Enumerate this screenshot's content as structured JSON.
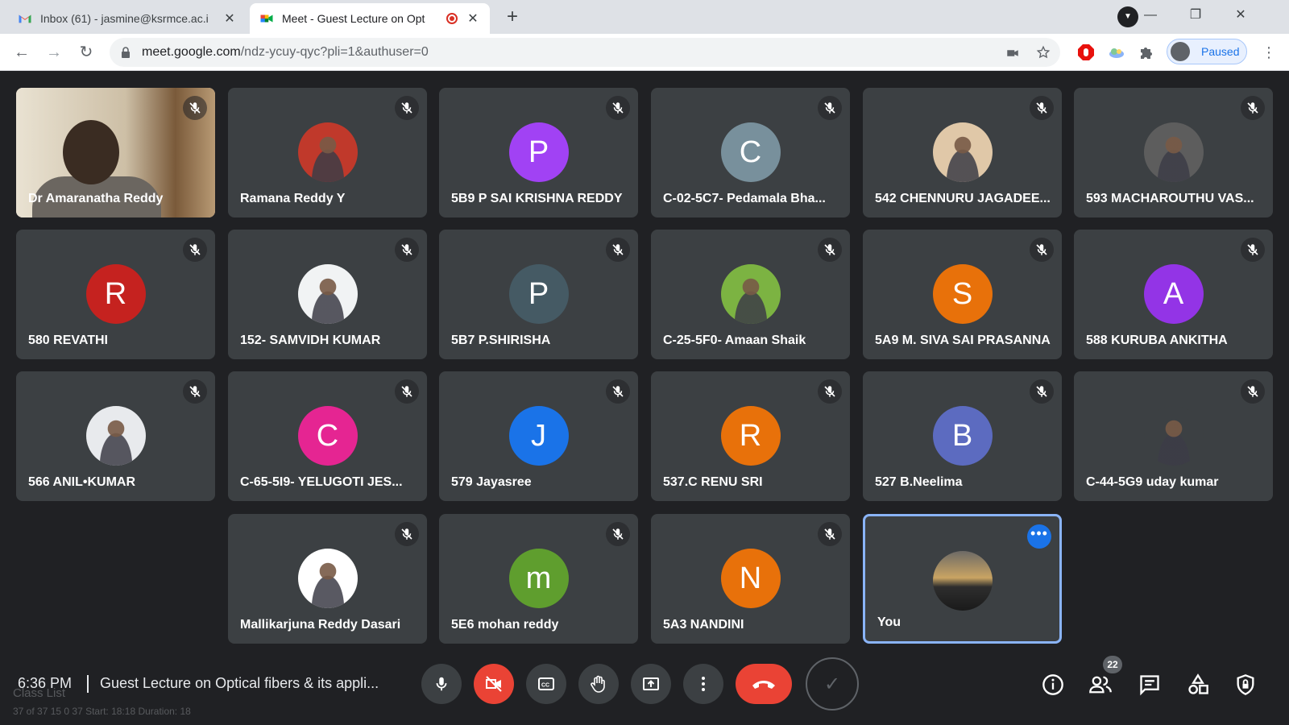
{
  "browser": {
    "tabs": [
      {
        "title": "Inbox (61) - jasmine@ksrmce.ac.i",
        "icon": "gmail-icon"
      },
      {
        "title": "Meet - Guest Lecture on Opt",
        "icon": "meet-icon",
        "recording": true
      }
    ],
    "url_host": "meet.google.com",
    "url_path": "/ndz-ycuy-qyc?pli=1&authuser=0",
    "profile_label": "Paused"
  },
  "participants": [
    {
      "name": "Dr Amaranatha Reddy",
      "type": "video"
    },
    {
      "name": "Ramana Reddy Y",
      "type": "photo",
      "color": "#c0392b"
    },
    {
      "name": "5B9 P SAI KRISHNA REDDY",
      "type": "initial",
      "initial": "P",
      "color": "#a142f4"
    },
    {
      "name": "C-02-5C7- Pedamala Bha...",
      "type": "initial",
      "initial": "C",
      "color": "#78909c"
    },
    {
      "name": "542 CHENNURU JAGADEE...",
      "type": "photo",
      "color": "#e0c8a8"
    },
    {
      "name": "593 MACHAROUTHU VAS...",
      "type": "photo",
      "color": "#5d5d5d"
    },
    {
      "name": "580 REVATHI",
      "type": "initial",
      "initial": "R",
      "color": "#c5221f"
    },
    {
      "name": "152- SAMVIDH KUMAR",
      "type": "photo",
      "color": "#f1f3f4"
    },
    {
      "name": "5B7 P.SHIRISHA",
      "type": "initial",
      "initial": "P",
      "color": "#455a64"
    },
    {
      "name": "C-25-5F0- Amaan Shaik",
      "type": "photo",
      "color": "#7cb342"
    },
    {
      "name": "5A9 M. SIVA SAI PRASANNA",
      "type": "initial",
      "initial": "S",
      "color": "#e8710a"
    },
    {
      "name": "588 KURUBA ANKITHA",
      "type": "initial",
      "initial": "A",
      "color": "#9334e6"
    },
    {
      "name": "566 ANIL•KUMAR",
      "type": "photo",
      "color": "#e8eaed"
    },
    {
      "name": "C-65-5I9- YELUGOTI JES...",
      "type": "initial",
      "initial": "C",
      "color": "#e52592"
    },
    {
      "name": "579 Jayasree",
      "type": "initial",
      "initial": "J",
      "color": "#1a73e8"
    },
    {
      "name": "537.C RENU SRI",
      "type": "initial",
      "initial": "R",
      "color": "#e8710a"
    },
    {
      "name": "527 B.Neelima",
      "type": "initial",
      "initial": "B",
      "color": "#5c6bc0"
    },
    {
      "name": "C-44-5G9 uday kumar",
      "type": "photo",
      "color": "#3c4043"
    },
    {
      "name": "Mallikarjuna Reddy Dasari",
      "type": "photo",
      "color": "#ffffff"
    },
    {
      "name": "5E6 mohan reddy",
      "type": "initial",
      "initial": "m",
      "color": "#5f9e2e"
    },
    {
      "name": "5A3 NANDINI",
      "type": "initial",
      "initial": "N",
      "color": "#e8710a"
    },
    {
      "name": "You",
      "type": "photo",
      "color": "#4a4a4a",
      "self": true
    }
  ],
  "bottom_bar": {
    "time": "6:36 PM",
    "meeting_title": "Guest Lecture on Optical fibers & its appli...",
    "extension_label": "Class List",
    "extension_stats": "37 of 37   15   0   37  Start: 18:18  Duration: 18",
    "participant_count": "22"
  }
}
